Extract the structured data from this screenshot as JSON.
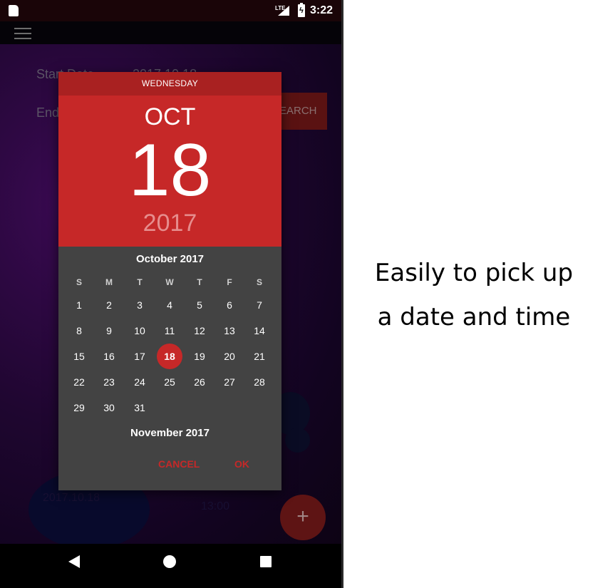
{
  "status_bar": {
    "network": "LTE",
    "time": "3:22"
  },
  "background": {
    "start_label": "Start Date",
    "start_value": "2017.10.18",
    "end_label": "End",
    "search_label": "SEARCH",
    "fab_label": "+",
    "faint_left": "2017.10.18",
    "faint_right": "13:00"
  },
  "date_picker": {
    "day_of_week": "WEDNESDAY",
    "month": "OCT",
    "day": "18",
    "year": "2017",
    "calendar_title": "October 2017",
    "weekday_headers": [
      "S",
      "M",
      "T",
      "W",
      "T",
      "F",
      "S"
    ],
    "weeks": [
      [
        "1",
        "2",
        "3",
        "4",
        "5",
        "6",
        "7"
      ],
      [
        "8",
        "9",
        "10",
        "11",
        "12",
        "13",
        "14"
      ],
      [
        "15",
        "16",
        "17",
        "18",
        "19",
        "20",
        "21"
      ],
      [
        "22",
        "23",
        "24",
        "25",
        "26",
        "27",
        "28"
      ],
      [
        "29",
        "30",
        "31",
        "",
        "",
        "",
        ""
      ]
    ],
    "selected_day": "18",
    "next_month_title": "November 2017",
    "cancel_label": "CANCEL",
    "ok_label": "OK",
    "accent_color": "#c62828"
  },
  "caption": {
    "line1": "Easily to pick up",
    "line2": "a date and time"
  }
}
